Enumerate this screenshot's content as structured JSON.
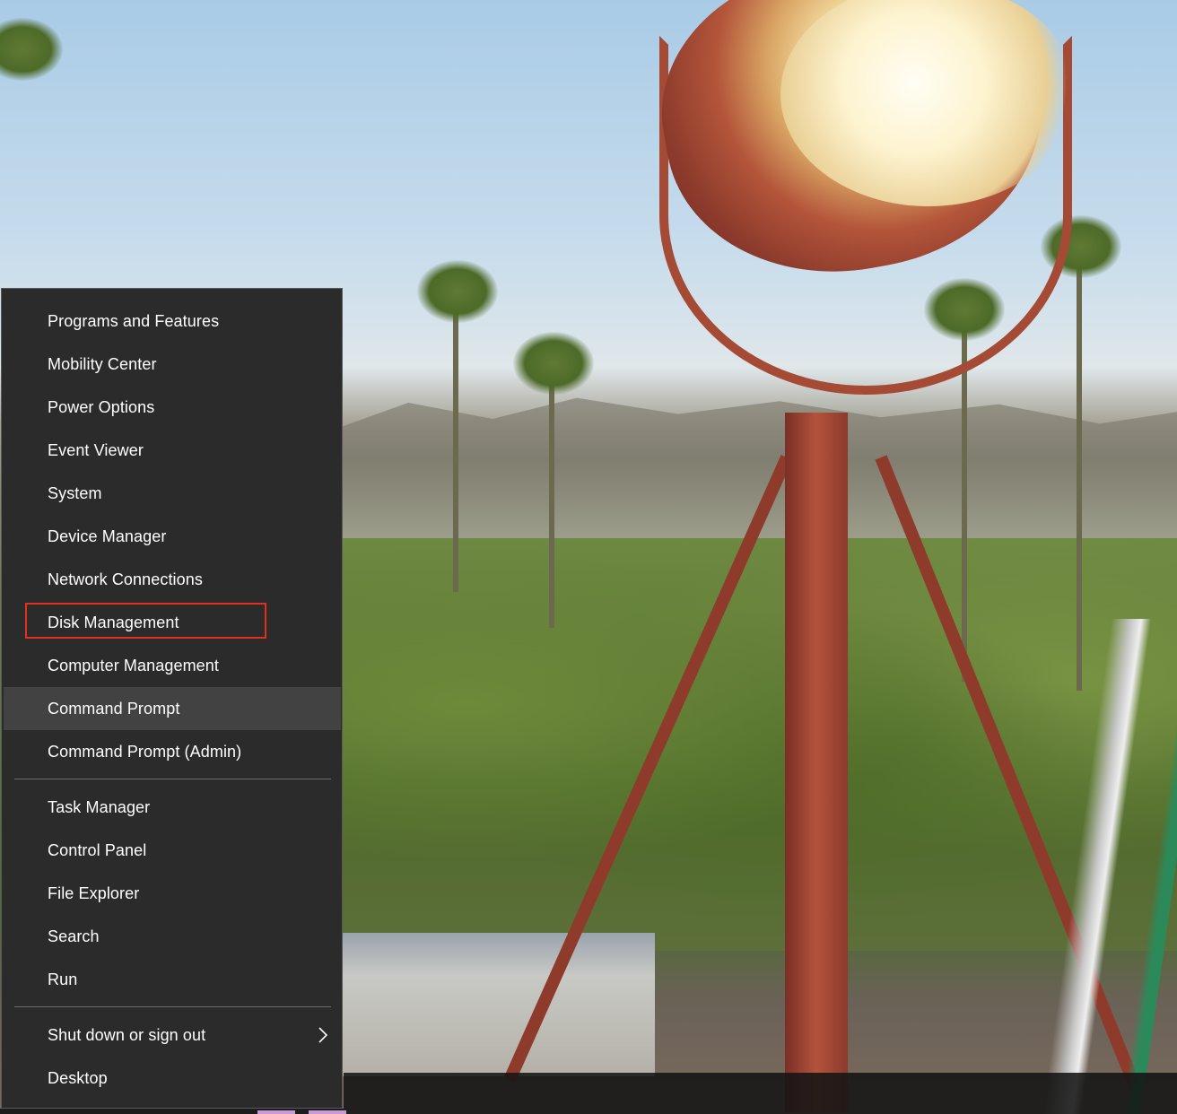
{
  "menu": {
    "items": [
      {
        "label": "Programs and Features"
      },
      {
        "label": "Mobility Center"
      },
      {
        "label": "Power Options"
      },
      {
        "label": "Event Viewer"
      },
      {
        "label": "System"
      },
      {
        "label": "Device Manager"
      },
      {
        "label": "Network Connections"
      },
      {
        "label": "Disk Management"
      },
      {
        "label": "Computer Management"
      },
      {
        "label": "Command Prompt"
      },
      {
        "label": "Command Prompt (Admin)"
      },
      {
        "label": "Task Manager"
      },
      {
        "label": "Control Panel"
      },
      {
        "label": "File Explorer"
      },
      {
        "label": "Search"
      },
      {
        "label": "Run"
      },
      {
        "label": "Shut down or sign out"
      },
      {
        "label": "Desktop"
      }
    ],
    "hovered_item": "Command Prompt",
    "highlighted_item": "Disk Management",
    "submenu_icon": "chevron-right-icon"
  },
  "colors": {
    "menu_background": "#2b2b2b",
    "hover_background": "#424242",
    "highlight_border": "#e0301e",
    "text": "#ffffff"
  }
}
